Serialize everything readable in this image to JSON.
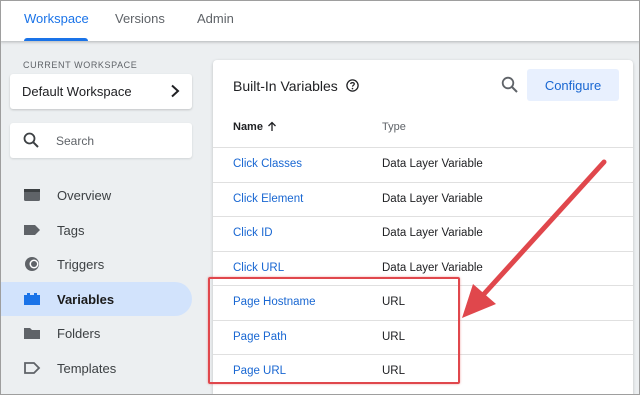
{
  "tabs": [
    {
      "label": "Workspace",
      "active": true
    },
    {
      "label": "Versions",
      "active": false
    },
    {
      "label": "Admin",
      "active": false
    }
  ],
  "sidebar": {
    "workspace_caption": "CURRENT WORKSPACE",
    "workspace_name": "Default Workspace",
    "search_placeholder": "Search",
    "items": [
      {
        "label": "Overview",
        "icon": "overview-icon"
      },
      {
        "label": "Tags",
        "icon": "tag-icon"
      },
      {
        "label": "Triggers",
        "icon": "trigger-icon"
      },
      {
        "label": "Variables",
        "icon": "variables-icon",
        "active": true
      },
      {
        "label": "Folders",
        "icon": "folder-icon"
      },
      {
        "label": "Templates",
        "icon": "template-icon"
      }
    ]
  },
  "main": {
    "title": "Built-In Variables",
    "configure_label": "Configure",
    "columns": {
      "name": "Name",
      "type": "Type"
    },
    "rows": [
      {
        "name": "Click Classes",
        "type": "Data Layer Variable"
      },
      {
        "name": "Click Element",
        "type": "Data Layer Variable"
      },
      {
        "name": "Click ID",
        "type": "Data Layer Variable"
      },
      {
        "name": "Click URL",
        "type": "Data Layer Variable"
      },
      {
        "name": "Page Hostname",
        "type": "URL"
      },
      {
        "name": "Page Path",
        "type": "URL"
      },
      {
        "name": "Page URL",
        "type": "URL"
      }
    ]
  },
  "colors": {
    "accent": "#1a73e8",
    "link": "#1967d2",
    "active_nav_bg": "#d2e3fc",
    "annotation": "#e0474c"
  }
}
